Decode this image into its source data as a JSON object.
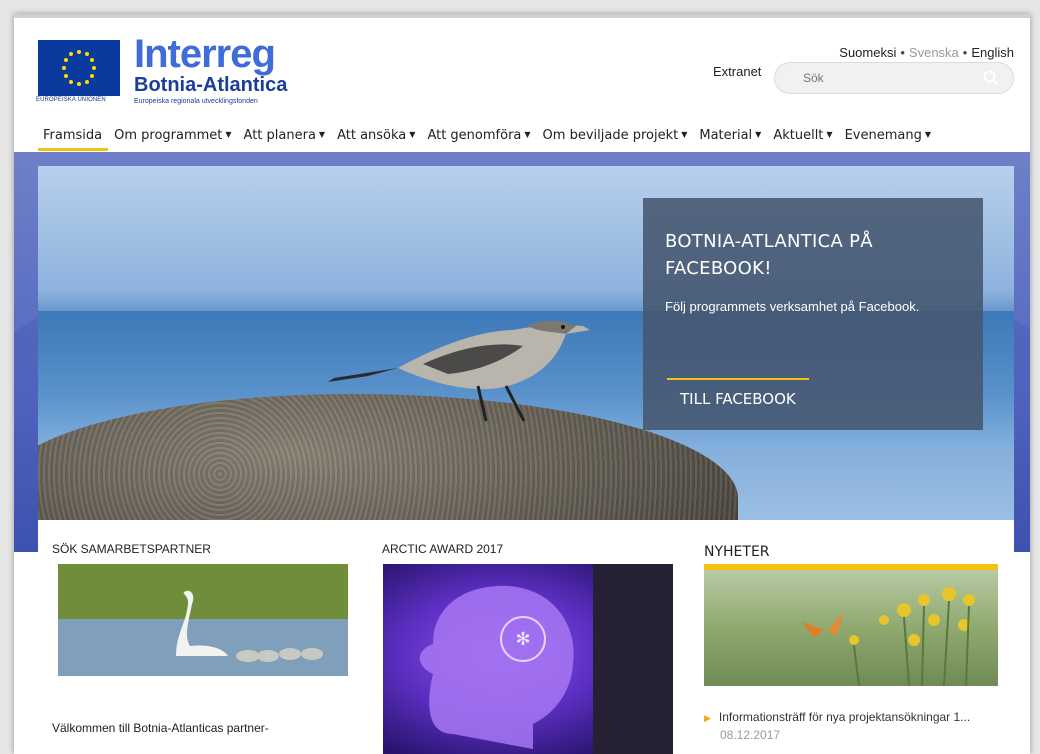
{
  "header": {
    "eu_caption": "EUROPEISKA UNIONEN",
    "brand_line1": "Interreg",
    "brand_line2": "Botnia-Atlantica",
    "brand_line3": "Europeiska regionala utvecklingsfonden",
    "extranet": "Extranet",
    "languages": [
      {
        "label": "Suomeksi",
        "active": false
      },
      {
        "label": "Svenska",
        "active": true
      },
      {
        "label": "English",
        "active": false
      }
    ],
    "search_placeholder": "Sök",
    "search_icon": "search-icon"
  },
  "nav": {
    "items": [
      {
        "label": "Framsida",
        "active": true,
        "has_dropdown": false
      },
      {
        "label": "Om programmet",
        "active": false,
        "has_dropdown": true
      },
      {
        "label": "Att planera",
        "active": false,
        "has_dropdown": true
      },
      {
        "label": "Att ansöka",
        "active": false,
        "has_dropdown": true
      },
      {
        "label": "Att genomföra",
        "active": false,
        "has_dropdown": true
      },
      {
        "label": "Om beviljade projekt",
        "active": false,
        "has_dropdown": true
      },
      {
        "label": "Material",
        "active": false,
        "has_dropdown": true
      },
      {
        "label": "Aktuellt",
        "active": false,
        "has_dropdown": true
      },
      {
        "label": "Evenemang",
        "active": false,
        "has_dropdown": true
      }
    ],
    "caret": "▼"
  },
  "hero": {
    "promo_title": "BOTNIA-ATLANTICA PÅ FACEBOOK!",
    "promo_text": "Följ programmets verksamhet på Facebook.",
    "promo_link": "TILL FACEBOOK"
  },
  "columns": {
    "partner_title": "SÖK SAMARBETSPARTNER",
    "award_title": "ARCTIC AWARD 2017",
    "news_title": "NYHETER",
    "partner_intro": "Välkommen till Botnia-Atlanticas partner-",
    "news_item": "Informationsträff för nya projektansökningar 1...",
    "news_date": "08.12.2017"
  },
  "colors": {
    "accent": "#f3c013",
    "brand_blue": "#3e6cd8",
    "eu_blue": "#0b3a9f"
  }
}
